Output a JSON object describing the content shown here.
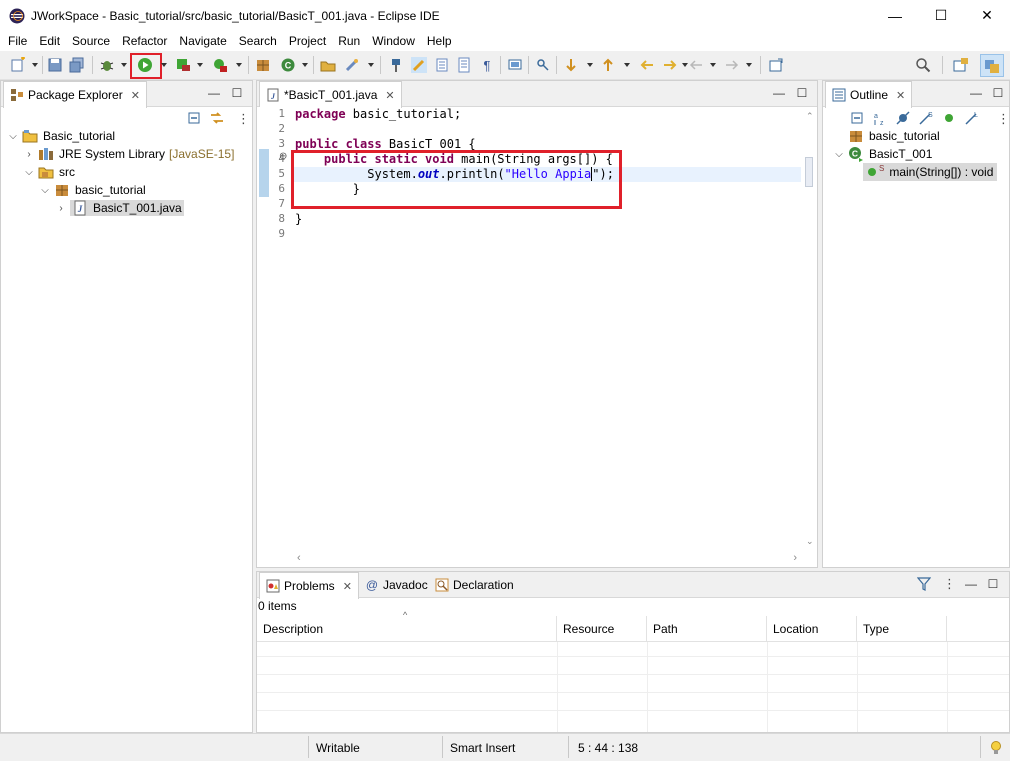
{
  "window": {
    "title": "JWorkSpace - Basic_tutorial/src/basic_tutorial/BasicT_001.java - Eclipse IDE",
    "minimize": "—",
    "maximize": "☐",
    "close": "✕"
  },
  "menu": [
    "File",
    "Edit",
    "Source",
    "Refactor",
    "Navigate",
    "Search",
    "Project",
    "Run",
    "Window",
    "Help"
  ],
  "package_explorer": {
    "tab_label": "Package Explorer",
    "tree": {
      "project": "Basic_tutorial",
      "jre_label": "JRE System Library",
      "jre_version": "[JavaSE-15]",
      "src": "src",
      "package": "basic_tutorial",
      "file": "BasicT_001.java"
    }
  },
  "editor": {
    "tab_label": "*BasicT_001.java",
    "line_numbers": [
      "1",
      "2",
      "3",
      "4",
      "5",
      "6",
      "7",
      "8",
      "9"
    ],
    "line1_kw": "package",
    "line1_rest": " basic_tutorial;",
    "line3_kw": "public class",
    "line3_rest": " BasicT_001 {",
    "line4_indent": "    ",
    "line4_kw": "public static void",
    "line4_rest": " main(String args[]) {",
    "line5_a": "          System.",
    "line5_out": "out",
    "line5_b": ".println(",
    "line5_str": "\"Hello Appia",
    "line5_c": "\");",
    "line6": "        }",
    "line8": "}"
  },
  "outline": {
    "tab_label": "Outline",
    "package": "basic_tutorial",
    "class": "BasicT_001",
    "method": "main(String[]) : void",
    "method_modifier": "S"
  },
  "bottom_panel": {
    "tabs": [
      {
        "label": "Problems"
      },
      {
        "label": "Javadoc"
      },
      {
        "label": "Declaration"
      }
    ],
    "items_count": "0 items",
    "columns": [
      "Description",
      "Resource",
      "Path",
      "Location",
      "Type"
    ]
  },
  "status": {
    "writable": "Writable",
    "insert_mode": "Smart Insert",
    "position": "5 : 44 : 138"
  },
  "colors": {
    "highlight_red": "#e0202a",
    "keyword": "#7f0055",
    "string": "#2a00ff",
    "field": "#0000c0"
  }
}
